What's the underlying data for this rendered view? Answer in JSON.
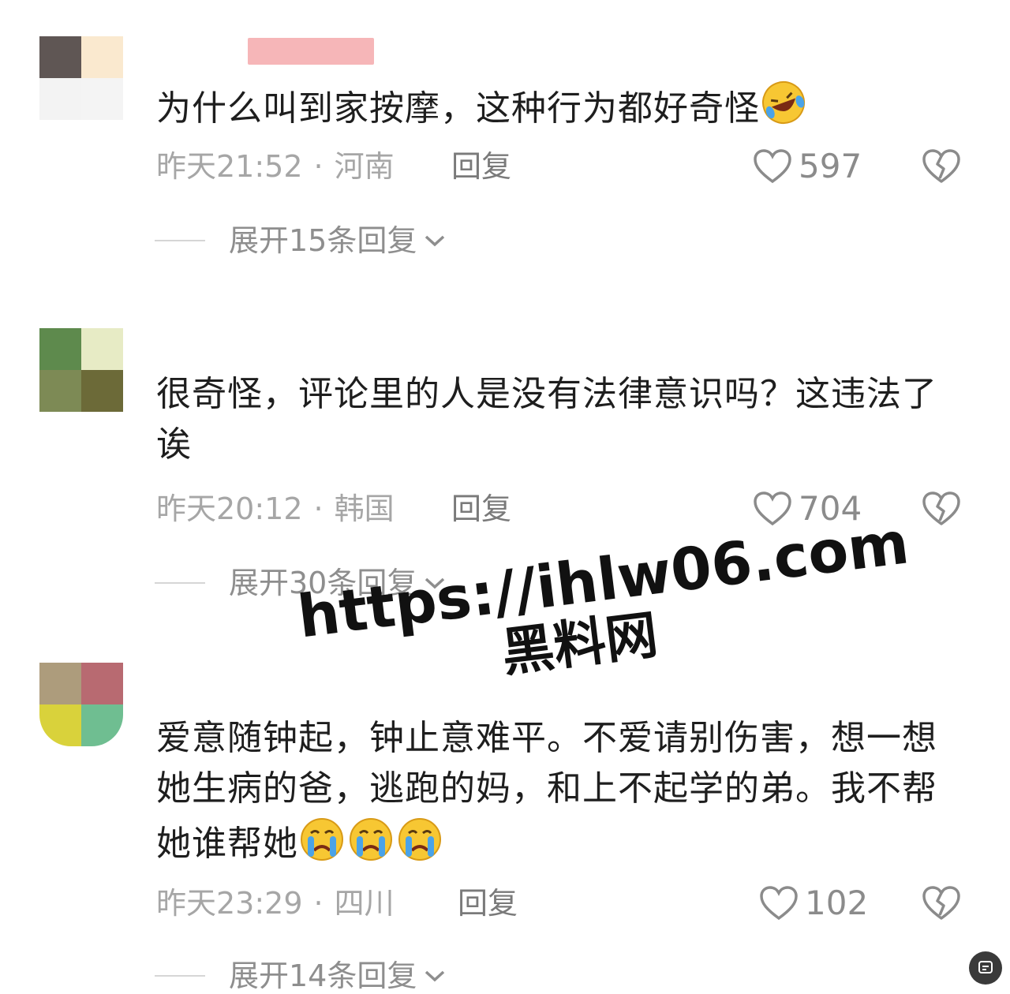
{
  "comments": [
    {
      "text": "为什么叫到家按摩，这种行为都好奇怪",
      "emoji": "rofl-emoji",
      "time": "昨天21:52",
      "location": "河南",
      "reply_label": "回复",
      "likes": "597",
      "expand_label": "展开15条回复"
    },
    {
      "text": "很奇怪，评论里的人是没有法律意识吗？这违法了诶",
      "time": "昨天20:12",
      "location": "韩国",
      "reply_label": "回复",
      "likes": "704",
      "expand_label": "展开30条回复"
    },
    {
      "text": "爱意随钟起，钟止意难平。不爱请别伤害，想一想她生病的爸，逃跑的妈，和上不起学的弟。我不帮她谁帮她",
      "emoji": "crying-emoji",
      "time": "昨天23:29",
      "location": "四川",
      "reply_label": "回复",
      "likes": "102",
      "expand_label": "展开14条回复"
    }
  ],
  "separator": "·",
  "watermark": {
    "url": "https://ihlw06.com",
    "site": "黑料网"
  },
  "colors": {
    "text": "#1e1e1e",
    "meta": "#a6a6a6",
    "like": "#8b8b8b"
  }
}
